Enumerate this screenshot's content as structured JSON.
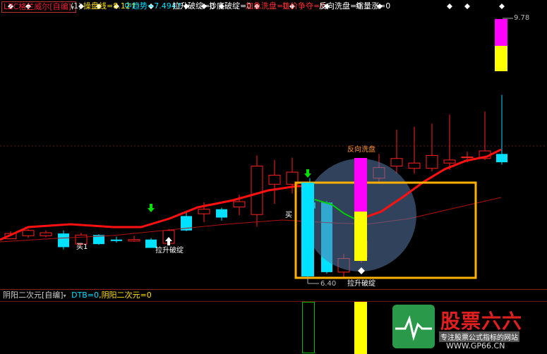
{
  "header": {
    "title": "LZC格兰威尔[自编]",
    "period": "(1)",
    "indicators": [
      {
        "text": "操盘线=8.12↑",
        "color": "#ffe000"
      },
      {
        "text": "中趋势=7.494↑",
        "color": "#00e0ff"
      },
      {
        "text": "拉升破绽=0",
        "color": "#ffffff"
      },
      {
        "text": "抄底破绽=0",
        "color": "#ffffff"
      },
      {
        "text": "加急洗盘=0",
        "color": "#ff3030"
      },
      {
        "text": "拉价争夺=0",
        "color": "#ff3030"
      },
      {
        "text": "反向洗盘=0",
        "color": "#ffffff"
      },
      {
        "text": "缩量涨=0",
        "color": "#ffffff"
      }
    ]
  },
  "price_labels": {
    "high": "9.78",
    "low": "6.40"
  },
  "annotations": {
    "buy1": "买1",
    "buy_mid": "买",
    "lift_break_1": "拉升破绽",
    "lift_break_2": "拉升破绽",
    "reverse_wash": "反向洗盘"
  },
  "sub_header": {
    "title": "阴阳二次元[自编]",
    "dtb": "DTB=0",
    "name": "阴阳二次元=0"
  },
  "watermark": {
    "brand": "股票六六",
    "slogan": "专注股票公式指标的网站",
    "url": "WWW.GP66.CN"
  },
  "colors": {
    "up": "#ff2020",
    "down": "#00e0ff",
    "ma_main": "#ff1010",
    "ma_mid": "#c01010",
    "highlight": "#ffb000",
    "magenta": "#ff00ff",
    "yellow": "#ffff00",
    "green": "#00cc00"
  },
  "chart_data": {
    "type": "candlestick",
    "candles": [
      {
        "o": 6.94,
        "c": 7.01,
        "h": 7.04,
        "l": 6.94
      },
      {
        "o": 6.98,
        "c": 7.05,
        "h": 7.07,
        "l": 6.95
      },
      {
        "o": 6.98,
        "c": 7.02,
        "h": 7.05,
        "l": 6.96
      },
      {
        "o": 7.01,
        "c": 6.83,
        "h": 7.05,
        "l": 6.8
      },
      {
        "o": 6.87,
        "c": 6.99,
        "h": 7.02,
        "l": 6.85
      },
      {
        "o": 6.99,
        "c": 6.87,
        "h": 7.0,
        "l": 6.86
      },
      {
        "o": 6.93,
        "c": 6.91,
        "h": 6.97,
        "l": 6.89
      },
      {
        "o": 6.91,
        "c": 6.93,
        "h": 6.98,
        "l": 6.9
      },
      {
        "o": 6.93,
        "c": 6.82,
        "h": 6.95,
        "l": 6.82
      },
      {
        "o": 6.88,
        "c": 7.05,
        "h": 7.07,
        "l": 6.88
      },
      {
        "o": 7.24,
        "c": 7.05,
        "h": 7.3,
        "l": 7.04
      },
      {
        "o": 7.27,
        "c": 7.33,
        "h": 7.42,
        "l": 7.16
      },
      {
        "o": 7.33,
        "c": 7.22,
        "h": 7.35,
        "l": 7.18
      },
      {
        "o": 7.36,
        "c": 7.43,
        "h": 7.52,
        "l": 7.25
      },
      {
        "o": 7.26,
        "c": 7.9,
        "h": 8.04,
        "l": 7.1
      },
      {
        "o": 7.66,
        "c": 7.78,
        "h": 7.98,
        "l": 7.4
      },
      {
        "o": 7.66,
        "c": 7.82,
        "h": 8.01,
        "l": 7.54
      },
      {
        "o": 7.42,
        "c": 7.34,
        "h": 7.74,
        "l": 7.2
      },
      {
        "o": 7.42,
        "c": 6.5,
        "h": 7.44,
        "l": 6.48
      },
      {
        "o": 6.5,
        "c": 6.68,
        "h": 6.74,
        "l": 6.43
      },
      {
        "o": 6.7,
        "c": 6.91,
        "h": 7.03,
        "l": 6.62
      },
      {
        "o": 7.74,
        "c": 7.88,
        "h": 8.06,
        "l": 7.68
      },
      {
        "o": 7.9,
        "c": 8.0,
        "h": 8.38,
        "l": 7.8
      },
      {
        "o": 7.87,
        "c": 7.94,
        "h": 8.42,
        "l": 7.8
      },
      {
        "o": 7.87,
        "c": 8.04,
        "h": 8.46,
        "l": 7.83
      },
      {
        "o": 7.94,
        "c": 7.98,
        "h": 8.58,
        "l": 7.85
      },
      {
        "o": 8.01,
        "c": 8.02,
        "h": 8.09,
        "l": 7.95
      },
      {
        "o": 8.0,
        "c": 8.1,
        "h": 8.62,
        "l": 7.98
      },
      {
        "o": 8.06,
        "c": 7.95,
        "h": 8.84,
        "l": 7.92
      }
    ],
    "ylim": [
      6.35,
      9.85
    ]
  }
}
